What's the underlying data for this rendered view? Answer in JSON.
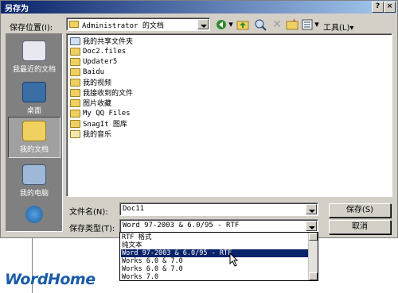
{
  "window": {
    "title": "另存为"
  },
  "title_buttons": {
    "help": "?",
    "close": "×"
  },
  "location": {
    "label": "保存位置(I):",
    "value": "Administrator 的文档"
  },
  "toolbar": {
    "tools_label": "工具(L)",
    "tools_arrow": "▾"
  },
  "places": [
    {
      "label": "我最近的文档",
      "icon": "recent-documents-icon"
    },
    {
      "label": "桌面",
      "icon": "desktop-icon"
    },
    {
      "label": "我的文档",
      "icon": "my-documents-icon"
    },
    {
      "label": "我的电脑",
      "icon": "my-computer-icon"
    },
    {
      "label": "",
      "icon": "network-places-icon"
    }
  ],
  "files": [
    {
      "name": "我的共享文件夹",
      "type": "shared-folder"
    },
    {
      "name": "Doc2.files",
      "type": "folder"
    },
    {
      "name": "Updater5",
      "type": "folder"
    },
    {
      "name": "Baidu",
      "type": "folder"
    },
    {
      "name": "我的视频",
      "type": "folder"
    },
    {
      "name": "我接收到的文件",
      "type": "folder"
    },
    {
      "name": "图片收藏",
      "type": "folder"
    },
    {
      "name": "My QQ Files",
      "type": "folder"
    },
    {
      "name": "SnagIt 图库",
      "type": "folder"
    },
    {
      "name": "我的音乐",
      "type": "folder"
    }
  ],
  "filename": {
    "label": "文件名(N):",
    "value": "Doc11"
  },
  "filetype": {
    "label": "保存类型(T):",
    "value": "Word 97-2003 & 6.0/95 - RTF"
  },
  "buttons": {
    "save": "保存(S)",
    "cancel": "取消"
  },
  "type_options": [
    {
      "label": "RTF 格式",
      "selected": false
    },
    {
      "label": "纯文本",
      "selected": false
    },
    {
      "label": "Word 97-2003 & 6.0/95 - RTF",
      "selected": true
    },
    {
      "label": "Works 6.0 & 7.0",
      "selected": false
    },
    {
      "label": "Works 6.0 & 7.0",
      "selected": false
    },
    {
      "label": "Works 7.0",
      "selected": false
    }
  ],
  "watermark": "WordHome",
  "colors": {
    "title_bar": "#0a246a",
    "selection": "#0a246a",
    "logo": "#1a5ca8",
    "folder": "#f0d060"
  }
}
